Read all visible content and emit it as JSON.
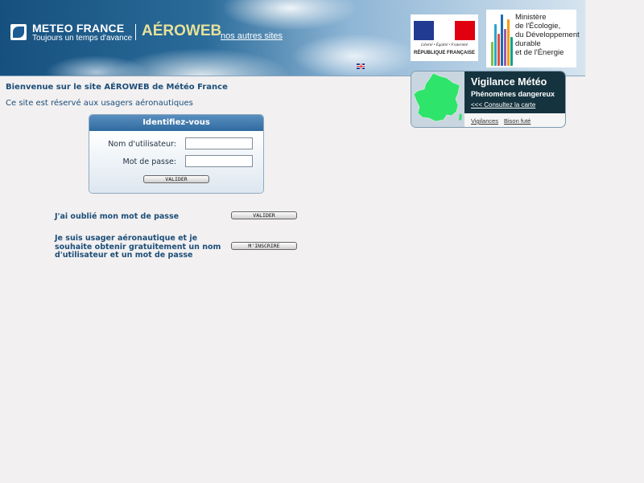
{
  "header": {
    "brand_name": "METEO FRANCE",
    "brand_tagline": "Toujours un temps d'avance",
    "site_name": "AÉROWEB",
    "other_sites_link": "nos autres sites",
    "republique_motto": "Liberté • Égalité • Fraternité",
    "republique_name": "RÉPUBLIQUE FRANÇAISE",
    "ministry_lines": [
      "Ministère",
      "de l'Écologie,",
      "du Développement",
      "durable",
      "et de l'Énergie"
    ]
  },
  "welcome": "Bienvenue sur le site AÉROWEB de Météo France",
  "reserved_notice": "Ce site est réservé aux usagers aéronautiques",
  "vigilance": {
    "title": "Vigilance Météo",
    "subtitle": "Phénomènes dangereux",
    "map_link": "<<< Consultez la carte",
    "footer_links": [
      "Vigilances",
      "Bison futé"
    ]
  },
  "login": {
    "title": "Identifiez-vous",
    "username_label": "Nom d'utilisateur:",
    "password_label": "Mot de passe:",
    "username_value": "",
    "password_value": "",
    "submit_label": "VALIDER"
  },
  "forgot_password": {
    "text": "J'ai oublié mon mot de passe",
    "button_label": "VALIDER"
  },
  "register": {
    "text": "Je suis usager aéronautique et je souhaite obtenir gratuitement un nom d'utilisateur et un mot de passe",
    "button_label": "M'INSCRIRE"
  },
  "colors": {
    "page_background": "#f2f0f1",
    "text_blue": "#1c4e78",
    "vigilance_dark": "#15333e",
    "france_green": "#2fe46a",
    "login_header": "#2f6a9f"
  },
  "icons": [
    "meteo-france-logo-icon",
    "uk-flag-icon",
    "france-map-icon"
  ]
}
